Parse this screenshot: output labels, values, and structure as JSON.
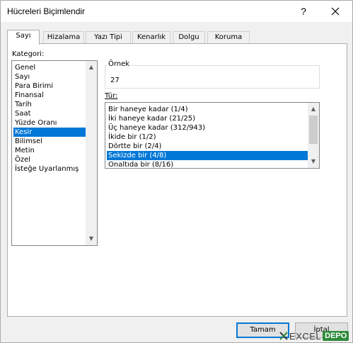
{
  "window": {
    "title": "Hücreleri Biçimlendir",
    "help_label": "?"
  },
  "tabs": [
    {
      "label": "Sayı",
      "active": true
    },
    {
      "label": "Hizalama",
      "active": false
    },
    {
      "label": "Yazı Tipi",
      "active": false
    },
    {
      "label": "Kenarlık",
      "active": false
    },
    {
      "label": "Dolgu",
      "active": false
    },
    {
      "label": "Koruma",
      "active": false
    }
  ],
  "category": {
    "label": "Kategori:",
    "items": [
      "Genel",
      "Sayı",
      "Para Birimi",
      "Finansal",
      "Tarih",
      "Saat",
      "Yüzde Oranı",
      "Kesir",
      "Bilimsel",
      "Metin",
      "Özel",
      "İsteğe Uyarlanmış"
    ],
    "selected": "Kesir"
  },
  "sample": {
    "label": "Örnek",
    "value": "27"
  },
  "type": {
    "label": "Tür:",
    "items": [
      "Bir haneye kadar (1/4)",
      "İki haneye kadar (21/25)",
      "Üç haneye kadar (312/943)",
      "İkide bir (1/2)",
      "Dörtte bir (2/4)",
      "Sekizde bir (4/8)",
      "Onaltıda bir (8/16)"
    ],
    "selected": "Sekizde bir (4/8)"
  },
  "buttons": {
    "ok": "Tamam",
    "cancel": "İptal"
  },
  "watermark": {
    "text": "EXCEL",
    "badge": "DEPO"
  },
  "colors": {
    "selection": "#0078d7",
    "accent": "#2e8b3a"
  }
}
